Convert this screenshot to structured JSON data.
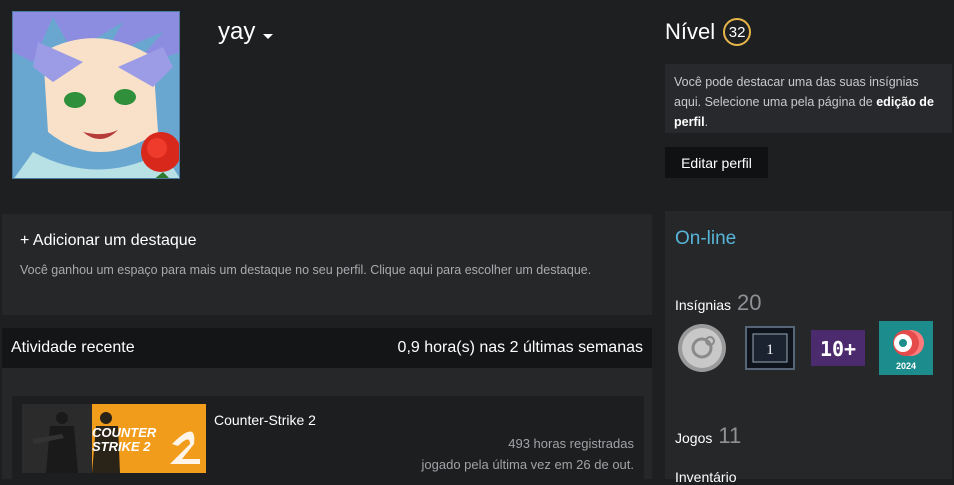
{
  "profile": {
    "persona_name": "yay"
  },
  "level": {
    "label": "Nível",
    "value": "32"
  },
  "badge_hint": {
    "text_before": "Você pode destacar uma das suas insígnias aqui. Selecione uma pela página de ",
    "link": "edição de perfil",
    "text_after": "."
  },
  "edit_profile_button": "Editar perfil",
  "showcase": {
    "title": "+ Adicionar um destaque",
    "description": "Você ganhou um espaço para mais um destaque no seu perfil. Clique aqui para escolher um destaque."
  },
  "activity": {
    "title": "Atividade recente",
    "summary": "0,9 hora(s) nas 2 últimas semanas",
    "games": [
      {
        "name": "Counter-Strike 2",
        "capsule_text": "COUNTER STRIKE 2",
        "hours": "493 horas registradas",
        "last_played": "jogado pela última vez em 26 de out."
      }
    ]
  },
  "sidebar": {
    "status": "On-line",
    "badges_label": "Insígnias",
    "badges_count": "20",
    "badges": [
      {
        "icon": "silver-coin-badge-icon"
      },
      {
        "icon": "years-of-service-1-badge-icon",
        "text": "1"
      },
      {
        "icon": "game-collector-10-badge-icon",
        "text": "10+"
      },
      {
        "icon": "steam-replay-2024-badge-icon",
        "text": "2024"
      }
    ],
    "games_label": "Jogos",
    "games_count": "11",
    "inventory_label": "Inventário"
  },
  "colors": {
    "background": "#1e1f21",
    "online": "#57b5d9",
    "level_ring": "#e6b54a",
    "cs2_capsule": "#f29c1c"
  }
}
